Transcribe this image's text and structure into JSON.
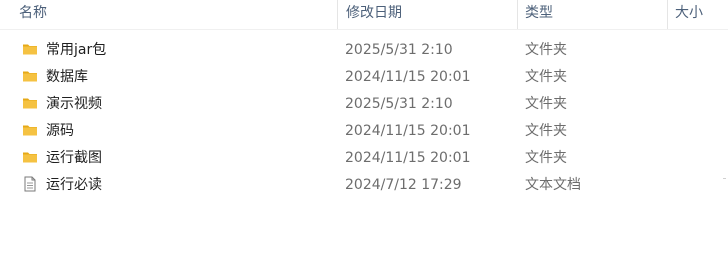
{
  "columns": {
    "name": "名称",
    "modified": "修改日期",
    "type": "类型",
    "size": "大小"
  },
  "files": [
    {
      "icon": "folder-icon",
      "name": "常用jar包",
      "modified": "2025/5/31 2:10",
      "type": "文件夹"
    },
    {
      "icon": "folder-icon",
      "name": "数据库",
      "modified": "2024/11/15 20:01",
      "type": "文件夹"
    },
    {
      "icon": "folder-icon",
      "name": "演示视频",
      "modified": "2025/5/31 2:10",
      "type": "文件夹"
    },
    {
      "icon": "folder-icon",
      "name": "源码",
      "modified": "2024/11/15 20:01",
      "type": "文件夹"
    },
    {
      "icon": "folder-icon",
      "name": "运行截图",
      "modified": "2024/11/15 20:01",
      "type": "文件夹"
    },
    {
      "icon": "text-document-icon",
      "name": "运行必读",
      "modified": "2024/7/12 17:29",
      "type": "文本文档"
    }
  ],
  "colors": {
    "folder": "#f5c242",
    "folder_dark": "#e6a917",
    "header_text": "#4c607a"
  }
}
